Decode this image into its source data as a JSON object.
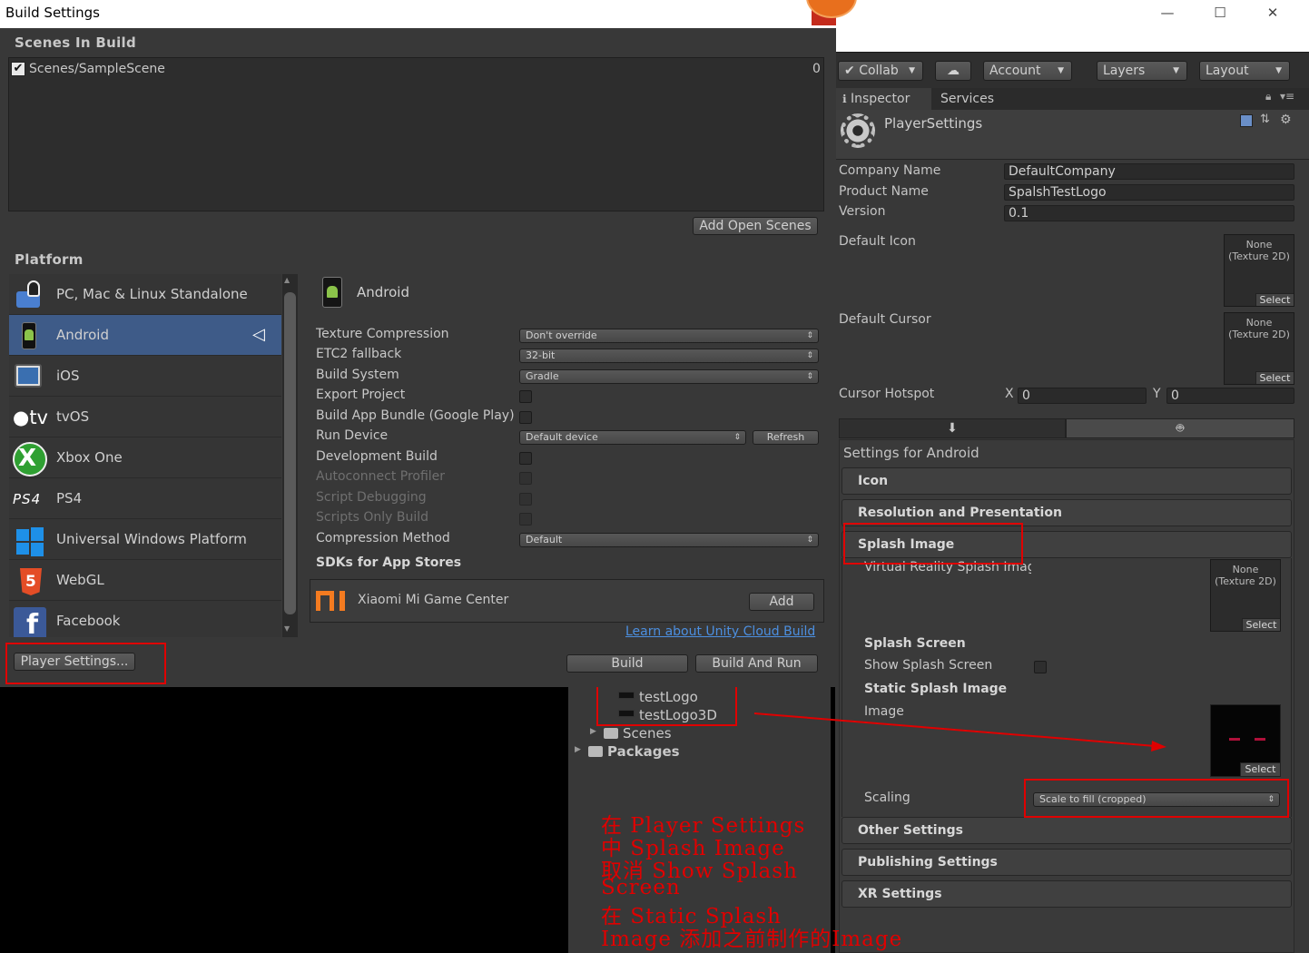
{
  "build_window": {
    "title": "Build Settings",
    "scenes_header": "Scenes In Build",
    "scenes": [
      {
        "name": "Scenes/SampleScene",
        "index": "0",
        "checked": true
      }
    ],
    "add_open_scenes": "Add Open Scenes",
    "platform_header": "Platform",
    "platforms": [
      {
        "label": "PC, Mac & Linux Standalone",
        "icon": "standalone-icon"
      },
      {
        "label": "Android",
        "icon": "android-icon",
        "active": true
      },
      {
        "label": "iOS",
        "icon": "ios-icon"
      },
      {
        "label": "tvOS",
        "icon": "tvos-icon"
      },
      {
        "label": "Xbox One",
        "icon": "xbox-icon"
      },
      {
        "label": "PS4",
        "icon": "ps4-icon"
      },
      {
        "label": "Universal Windows Platform",
        "icon": "windows-icon"
      },
      {
        "label": "WebGL",
        "icon": "html5-icon"
      },
      {
        "label": "Facebook",
        "icon": "facebook-icon"
      }
    ],
    "tvos_prefix": "tv",
    "ps4_logo": "PS4",
    "selected_platform": "Android",
    "options": {
      "texture_compression": {
        "label": "Texture Compression",
        "value": "Don't override"
      },
      "etc2_fallback": {
        "label": "ETC2 fallback",
        "value": "32-bit"
      },
      "build_system": {
        "label": "Build System",
        "value": "Gradle"
      },
      "export_project": {
        "label": "Export Project"
      },
      "build_app_bundle": {
        "label": "Build App Bundle (Google Play)"
      },
      "run_device": {
        "label": "Run Device",
        "value": "Default device",
        "refresh": "Refresh"
      },
      "development_build": {
        "label": "Development Build"
      },
      "autoconnect_profiler": {
        "label": "Autoconnect Profiler"
      },
      "script_debugging": {
        "label": "Script Debugging"
      },
      "scripts_only_build": {
        "label": "Scripts Only Build"
      },
      "compression_method": {
        "label": "Compression Method",
        "value": "Default"
      }
    },
    "sdks_header": "SDKs for App Stores",
    "sdk_item": {
      "label": "Xiaomi Mi Game Center",
      "add": "Add"
    },
    "cloud_link": "Learn about Unity Cloud Build",
    "build": "Build",
    "build_and_run": "Build And Run",
    "player_settings": "Player Settings..."
  },
  "editor": {
    "window_controls": {
      "minimize": "—",
      "maximize": "☐",
      "close": "✕"
    },
    "toolbar": {
      "collab": "Collab",
      "account": "Account",
      "layers": "Layers",
      "layout": "Layout"
    },
    "tabs": {
      "inspector": "Inspector",
      "services": "Services"
    },
    "asset_title": "PlayerSettings",
    "company_name": {
      "label": "Company Name",
      "value": "DefaultCompany"
    },
    "product_name": {
      "label": "Product Name",
      "value": "SpalshTestLogo"
    },
    "version": {
      "label": "Version",
      "value": "0.1"
    },
    "default_icon": {
      "label": "Default Icon",
      "slot_none": "None",
      "slot_type": "(Texture 2D)",
      "select": "Select"
    },
    "default_cursor": {
      "label": "Default Cursor",
      "slot_none": "None",
      "slot_type": "(Texture 2D)",
      "select": "Select"
    },
    "cursor_hotspot": {
      "label": "Cursor Hotspot",
      "x_label": "X",
      "x": "0",
      "y_label": "Y",
      "y": "0"
    },
    "settings_for": "Settings for Android",
    "sections": {
      "icon": "Icon",
      "resolution": "Resolution and Presentation",
      "splash": "Splash Image",
      "other": "Other Settings",
      "publishing": "Publishing Settings",
      "xr": "XR Settings"
    },
    "splash": {
      "vr_label": "Virtual Reality Splash Imag",
      "vr_slot_none": "None",
      "vr_slot_type": "(Texture 2D)",
      "vr_select": "Select",
      "splash_screen_header": "Splash Screen",
      "show_splash": "Show Splash Screen",
      "static_header": "Static Splash Image",
      "image_label": "Image",
      "image_select": "Select",
      "scaling_label": "Scaling",
      "scaling_value": "Scale to fill (cropped)"
    }
  },
  "project": {
    "items": [
      {
        "label": "testLogo"
      },
      {
        "label": "testLogo3D"
      }
    ],
    "folders": [
      {
        "label": "Scenes"
      },
      {
        "label": "Packages"
      }
    ]
  },
  "annotation": {
    "lines": [
      "在 Player Settings",
      "中 Splash Image",
      "取消 Show Splash",
      "Screen",
      "在 Static Splash",
      "Image 添加之前制作的Image"
    ]
  },
  "colors": {
    "panel": "#383838",
    "selection": "#3e5b88",
    "annotation_red": "#e00000",
    "link": "#4c8fe0"
  }
}
